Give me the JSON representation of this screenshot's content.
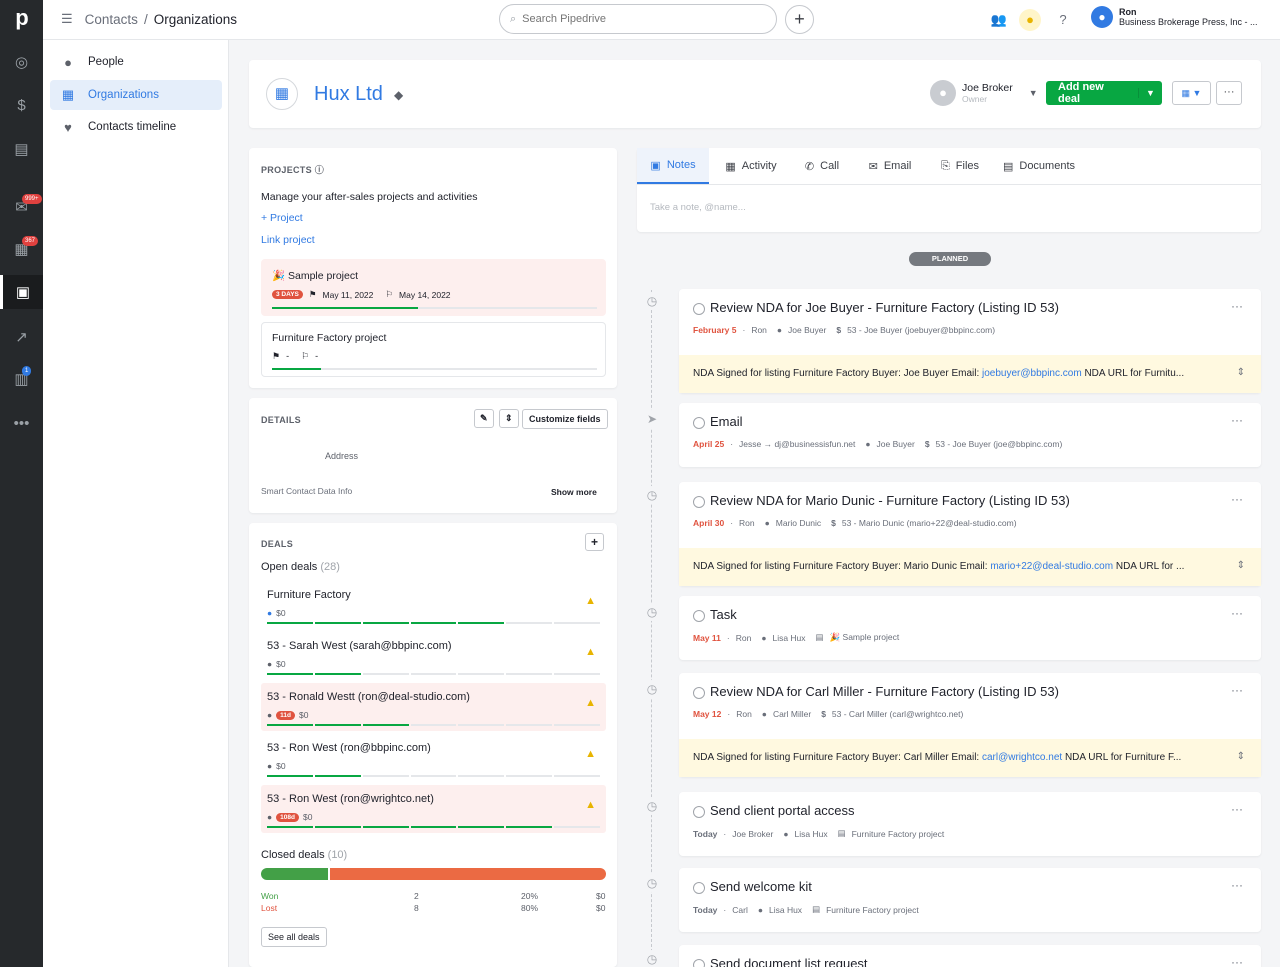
{
  "nav": {
    "logo": "p",
    "badges": {
      "inbox": "999+",
      "calendar": "367",
      "marketplace": "1"
    }
  },
  "topbar": {
    "breadcrumb_root": "Contacts",
    "breadcrumb_sep": "/",
    "breadcrumb_current": "Organizations",
    "search_placeholder": "Search Pipedrive",
    "user_name": "Ron",
    "user_company": "Business Brokerage Press, Inc - ..."
  },
  "sidebar": {
    "items": [
      {
        "label": "People",
        "icon": "person-icon"
      },
      {
        "label": "Organizations",
        "icon": "building-icon",
        "active": true
      },
      {
        "label": "Contacts timeline",
        "icon": "heartbeat-icon"
      }
    ]
  },
  "org": {
    "name": "Hux Ltd",
    "owner_name": "Joe Broker",
    "owner_role": "Owner",
    "add_deal_label": "Add new deal"
  },
  "projects": {
    "title": "PROJECTS",
    "description": "Manage your after-sales projects and activities",
    "add_label": "+ Project",
    "link_label": "Link project",
    "items": [
      {
        "name": "🎉 Sample project",
        "chip": "3 DAYS",
        "start": "May 11, 2022",
        "end": "May 14, 2022",
        "progress": 0.45
      },
      {
        "name": "Furniture Factory project",
        "start": "-",
        "end": "-",
        "progress": 0.15
      }
    ]
  },
  "details": {
    "title": "DETAILS",
    "customize_label": "Customize fields",
    "address_label": "Address",
    "smart_label": "Smart Contact Data Info",
    "show_more": "Show more"
  },
  "deals": {
    "title": "DEALS",
    "open_label": "Open deals",
    "open_count": "(28)",
    "items": [
      {
        "name": "Furniture Factory",
        "chip": "",
        "value": "$0",
        "red": false,
        "stages": 5
      },
      {
        "name": "53 - Sarah West (sarah@bbpinc.com)",
        "chip": "",
        "value": "$0",
        "red": false,
        "stages": 2
      },
      {
        "name": "53 - Ronald Westt (ron@deal-studio.com)",
        "chip": "11d",
        "value": "$0",
        "red": true,
        "stages": 3
      },
      {
        "name": "53 - Ron West (ron@bbpinc.com)",
        "chip": "",
        "value": "$0",
        "red": false,
        "stages": 2
      },
      {
        "name": "53 - Ron West (ron@wrightco.net)",
        "chip": "108d",
        "value": "$0",
        "red": true,
        "stages": 6
      }
    ],
    "closed_label": "Closed deals",
    "closed_count": "(10)",
    "won_share": 0.2,
    "won_label": "Won",
    "won_count": "2",
    "won_pct": "20%",
    "won_value": "$0",
    "lost_label": "Lost",
    "lost_count": "8",
    "lost_pct": "80%",
    "lost_value": "$0",
    "see_all": "See all deals"
  },
  "tabs": [
    {
      "label": "Notes",
      "icon": "note-icon",
      "active": true
    },
    {
      "label": "Activity",
      "icon": "calendar-icon"
    },
    {
      "label": "Call",
      "icon": "phone-icon"
    },
    {
      "label": "Email",
      "icon": "email-icon"
    },
    {
      "label": "Files",
      "icon": "paperclip-icon"
    },
    {
      "label": "Documents",
      "icon": "document-icon"
    }
  ],
  "note_placeholder": "Take a note, @name...",
  "planned_label": "PLANNED",
  "activities": [
    {
      "title": "Review NDA for Joe Buyer - Furniture Factory (Listing ID 53)",
      "date": "February 5",
      "by": "Ron",
      "person": "Joe Buyer",
      "deal": "53 - Joe Buyer (joebuyer@bbpinc.com)",
      "note_a": "NDA Signed for listing Furniture Factory Buyer: Joe Buyer Email: ",
      "note_link": "joebuyer@bbpinc.com",
      "note_b": " NDA URL for Furnitu..."
    },
    {
      "title": "Email",
      "date": "April 25",
      "by": "Jesse → dj@businessisfun.net",
      "person": "Joe Buyer",
      "deal": "53 - Joe Buyer (joe@bbpinc.com)"
    },
    {
      "title": "Review NDA for Mario Dunic - Furniture Factory (Listing ID 53)",
      "date": "April 30",
      "by": "Ron",
      "person": "Mario Dunic",
      "deal": "53 - Mario Dunic (mario+22@deal-studio.com)",
      "note_a": "NDA Signed for listing Furniture Factory Buyer: Mario Dunic Email: ",
      "note_link": "mario+22@deal-studio.com",
      "note_b": " NDA URL for ..."
    },
    {
      "title": "Task",
      "date": "May 11",
      "by": "Ron",
      "person": "Lisa Hux",
      "project": "🎉 Sample project"
    },
    {
      "title": "Review NDA for Carl Miller - Furniture Factory (Listing ID 53)",
      "date": "May 12",
      "by": "Ron",
      "person": "Carl Miller",
      "deal": "53 - Carl Miller (carl@wrightco.net)",
      "note_a": "NDA Signed for listing Furniture Factory Buyer: Carl Miller Email: ",
      "note_link": "carl@wrightco.net",
      "note_b": " NDA URL for Furniture F..."
    },
    {
      "title": "Send client portal access",
      "date": "Today",
      "by": "Joe Broker",
      "person": "Lisa Hux",
      "project": "Furniture Factory project"
    },
    {
      "title": "Send welcome kit",
      "date": "Today",
      "by": "Carl",
      "person": "Lisa Hux",
      "project": "Furniture Factory project"
    },
    {
      "title": "Send document list request"
    }
  ]
}
